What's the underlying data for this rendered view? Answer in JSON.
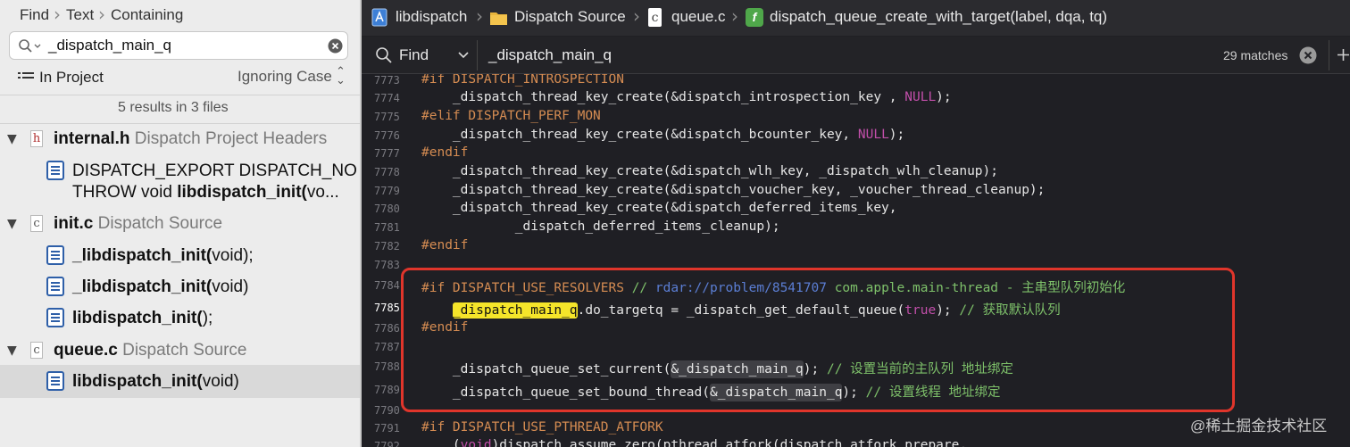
{
  "navigator": {
    "breadcrumb": [
      "Find",
      "Text",
      "Containing"
    ],
    "search_value": "_dispatch_main_q",
    "scope": "In Project",
    "case": "Ignoring Case",
    "summary": "5 results in 3 files",
    "groups": [
      {
        "file": "internal.h",
        "subtitle": "Dispatch Project Headers",
        "icon_letter": "h",
        "results": [
          {
            "line1": "DISPATCH_EXPORT DISPATCH_NO",
            "line2_pre": "THROW void ",
            "line2_bold": "libdispatch_init(",
            "line2_post": "vo..."
          }
        ]
      },
      {
        "file": "init.c",
        "subtitle": "Dispatch Source",
        "icon_letter": "c",
        "results": [
          {
            "bold": "_libdispatch_init(",
            "rest": "void);"
          },
          {
            "bold": "_libdispatch_init(",
            "rest": "void)"
          },
          {
            "bold": "libdispatch_init(",
            "rest": ");"
          }
        ]
      },
      {
        "file": "queue.c",
        "subtitle": "Dispatch Source",
        "icon_letter": "c",
        "results": [
          {
            "bold": "libdispatch_init(",
            "rest": "void)"
          }
        ]
      }
    ]
  },
  "jumpbar": {
    "project": "libdispatch",
    "folder": "Dispatch Source",
    "file": "queue.c",
    "symbol": "dispatch_queue_create_with_target(label, dqa, tq)",
    "symbol_badge": "f"
  },
  "findbar": {
    "mode": "Find",
    "query": "_dispatch_main_q",
    "matches": "29 matches"
  },
  "code": {
    "line_numbers": [
      "7773",
      "7774",
      "7775",
      "7776",
      "7777",
      "7778",
      "7779",
      "7780",
      "7781",
      "7782",
      "7783",
      "7784",
      "7785",
      "7786",
      "7787",
      "7788",
      "7789",
      "7790",
      "7791",
      "7792"
    ],
    "l7773": "#if DISPATCH_INTROSPECTION",
    "l7774a": "    _dispatch_thread_key_create(&dispatch_introspection_key , ",
    "l7774b": "NULL",
    "l7774c": ");",
    "l7775": "#elif DISPATCH_PERF_MON",
    "l7776a": "    _dispatch_thread_key_create(&dispatch_bcounter_key, ",
    "l7776b": "NULL",
    "l7776c": ");",
    "l7777": "#endif",
    "l7778": "    _dispatch_thread_key_create(&dispatch_wlh_key, _dispatch_wlh_cleanup);",
    "l7779": "    _dispatch_thread_key_create(&dispatch_voucher_key, _voucher_thread_cleanup);",
    "l7780": "    _dispatch_thread_key_create(&dispatch_deferred_items_key,",
    "l7781": "            _dispatch_deferred_items_cleanup);",
    "l7782": "#endif",
    "l7784a": "#if DISPATCH_USE_RESOLVERS ",
    "l7784b": "// ",
    "l7784c": "rdar://problem/8541707",
    "l7784d": " com.apple.main-thread - 主串型队列初始化",
    "l7785a": "    ",
    "l7785b": "_dispatch_main_q",
    "l7785c": ".do_targetq = _dispatch_get_default_queue(",
    "l7785d": "true",
    "l7785e": "); ",
    "l7785f": "// 获取默认队列",
    "l7786": "#endif",
    "l7788a": "    _dispatch_queue_set_current(",
    "l7788b": "&_dispatch_main_q",
    "l7788c": "); ",
    "l7788d": "// 设置当前的主队列 地址绑定",
    "l7789a": "    _dispatch_queue_set_bound_thread(",
    "l7789b": "&_dispatch_main_q",
    "l7789c": "); ",
    "l7789d": "// 设置线程 地址绑定",
    "l7791": "#if DISPATCH_USE_PTHREAD_ATFORK",
    "l7792a": "    (",
    "l7792b": "void",
    "l7792c": ")dispatch_assume_zero(pthread_atfork(dispatch_atfork_prepare,"
  },
  "watermark": "@稀土掘金技术社区",
  "colors": {
    "highlight": "#f5e52a",
    "annotation_box": "#e0352b",
    "preprocessor": "#d58c52",
    "keyword": "#c24faa",
    "comment": "#7ec16a"
  }
}
